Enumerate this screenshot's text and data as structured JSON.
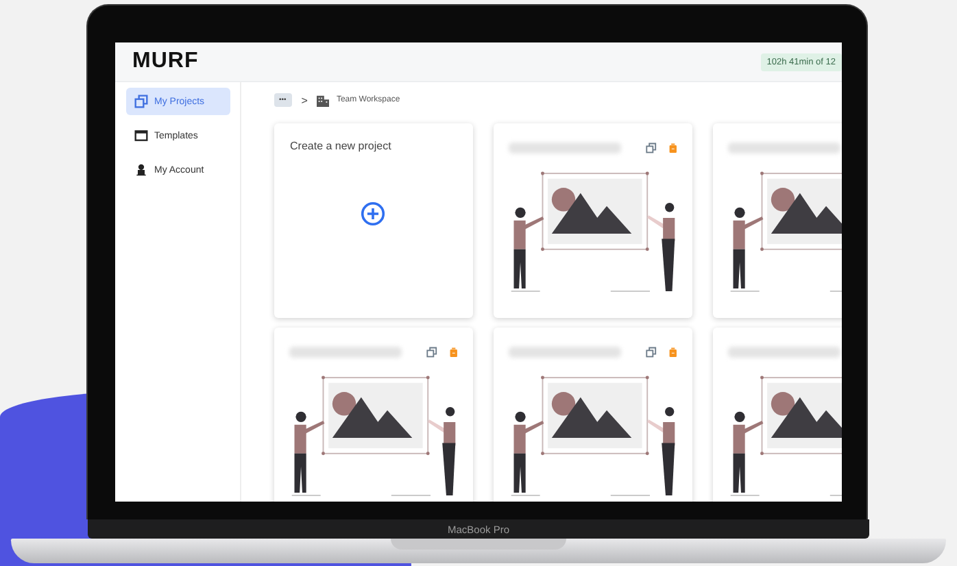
{
  "device": {
    "label": "MacBook Pro"
  },
  "app": {
    "logo": "MURF",
    "usage_badge": "102h 41min of 12"
  },
  "sidebar": {
    "items": [
      {
        "label": "My Projects",
        "selected": true
      },
      {
        "label": "Templates",
        "selected": false
      },
      {
        "label": "My Account",
        "selected": false
      }
    ]
  },
  "breadcrumb": {
    "more": "•••",
    "separator": ">",
    "current": "Team Workspace"
  },
  "cards": [
    {
      "kind": "create",
      "title": "Create a new project"
    },
    {
      "kind": "project"
    },
    {
      "kind": "project"
    },
    {
      "kind": "project"
    },
    {
      "kind": "project"
    },
    {
      "kind": "project"
    }
  ]
}
